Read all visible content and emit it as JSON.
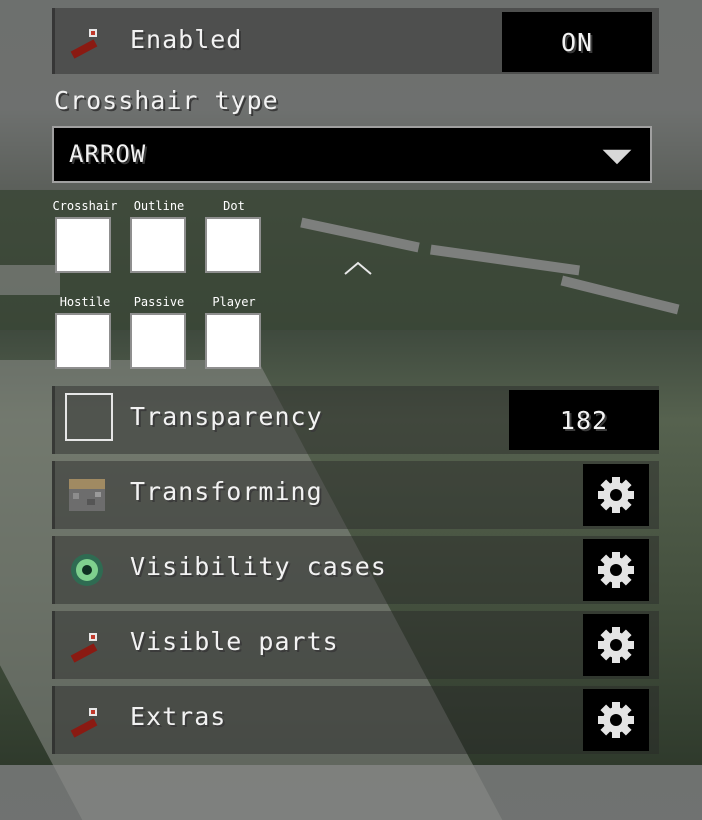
{
  "enabled": {
    "label": "Enabled",
    "value": "ON"
  },
  "crosshair_type": {
    "heading": "Crosshair type",
    "selected": "ARROW"
  },
  "color_swatches": {
    "row1": [
      "Crosshair",
      "Outline",
      "Dot"
    ],
    "row2": [
      "Hostile",
      "Passive",
      "Player"
    ]
  },
  "transparency": {
    "label": "Transparency",
    "value": "182"
  },
  "settings": [
    {
      "label": "Transforming",
      "icon": "piston-icon"
    },
    {
      "label": "Visibility cases",
      "icon": "ender-eye-icon"
    },
    {
      "label": "Visible parts",
      "icon": "redstone-torch-icon"
    },
    {
      "label": "Extras",
      "icon": "redstone-torch-icon"
    }
  ]
}
